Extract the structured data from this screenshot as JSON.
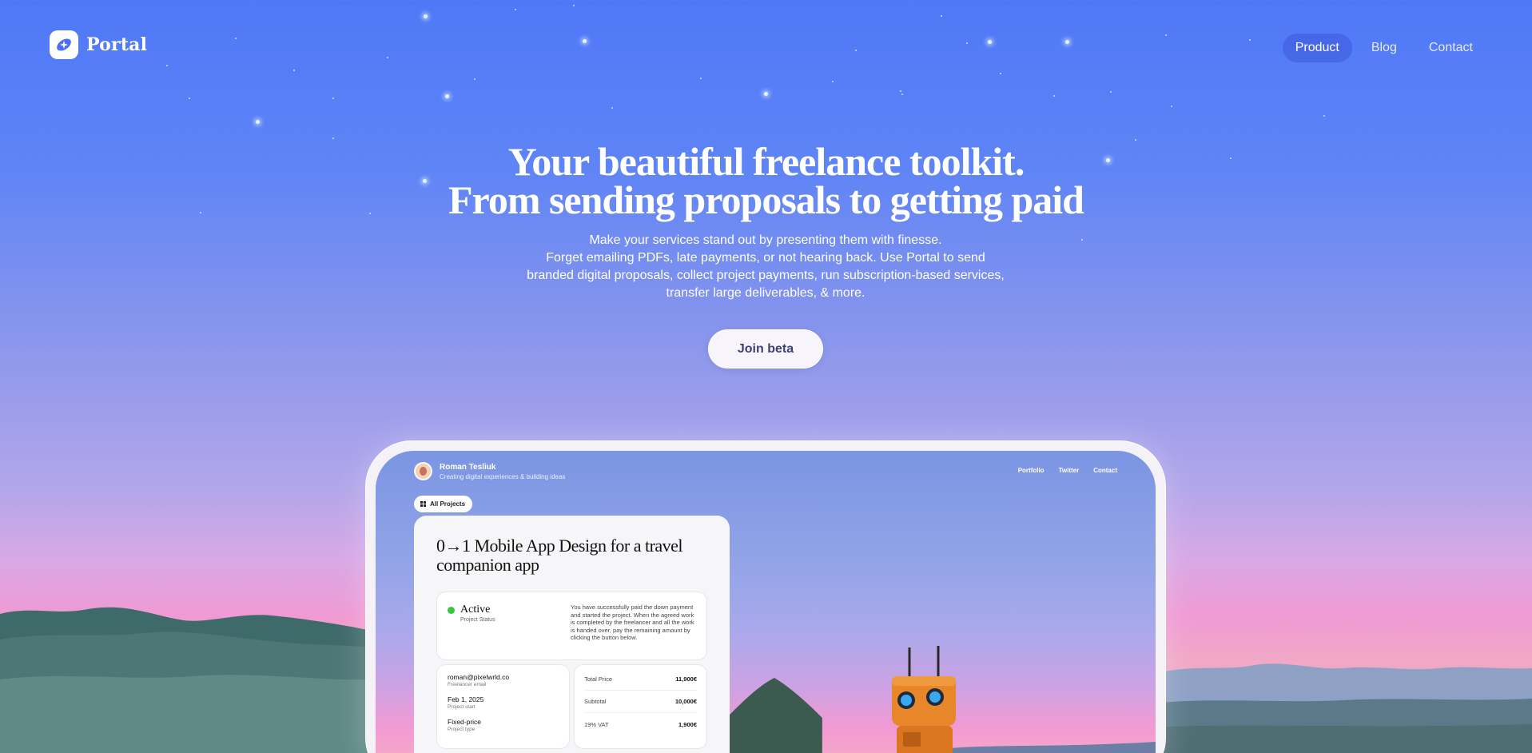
{
  "brand": {
    "name": "Portal",
    "icon": "portal-logo-icon"
  },
  "nav": {
    "items": [
      "Product",
      "Blog",
      "Contact"
    ],
    "active": "Product"
  },
  "hero": {
    "title_line1": "Your beautiful freelance toolkit.",
    "title_line2": "From sending proposals to getting paid",
    "sub_line1": "Make your services stand out by presenting them with finesse.",
    "sub_line2": "Forget emailing PDFs, late payments, or not hearing back. Use Portal to send branded digital proposals, collect project payments, run subscription-based services, transfer large deliverables, & more.",
    "cta": "Join beta"
  },
  "preview": {
    "profile": {
      "name": "Roman Tesliuk",
      "tagline": "Creating digital experiences & building ideas"
    },
    "nav": [
      "Portfolio",
      "Twitter",
      "Contact"
    ],
    "all_projects": "All Projects",
    "project_title": "0→1 Mobile App Design for a travel companion app",
    "status": {
      "label": "Active",
      "sublabel": "Project Status",
      "description": "You have successfully paid the down payment and started the project. When the agreed work is completed by the freelancer and all the work is handed over, pay the remaining amount by clicking the button below."
    },
    "info": [
      {
        "value": "roman@pixelwrld.co",
        "label": "Freelancer email"
      },
      {
        "value": "Feb 1, 2025",
        "label": "Project start"
      },
      {
        "value": "Fixed-price",
        "label": "Project type"
      }
    ],
    "pricing": [
      {
        "label": "Total Price",
        "value": "11,900€"
      },
      {
        "label": "Subtotal",
        "value": "10,000€"
      },
      {
        "label": "19% VAT",
        "value": "1,900€"
      }
    ]
  },
  "colors": {
    "sky_top": "#4f78f7",
    "sunset_pink": "#f09ad2",
    "cta_text": "#3e3f72",
    "status_active": "#36c742",
    "robot_orange": "#e8862a"
  }
}
